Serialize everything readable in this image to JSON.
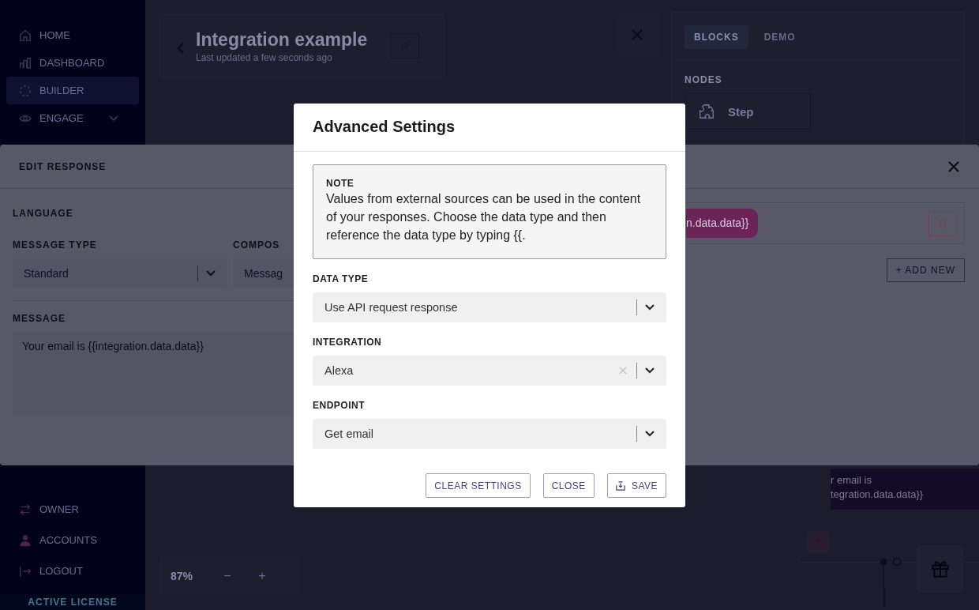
{
  "sidebar": {
    "items": [
      {
        "label": "HOME",
        "selected": false,
        "submenu": false
      },
      {
        "label": "DASHBOARD",
        "selected": false,
        "submenu": false
      },
      {
        "label": "BUILDER",
        "selected": true,
        "submenu": false
      },
      {
        "label": "ENGAGE",
        "selected": false,
        "submenu": true
      }
    ],
    "footer_items": [
      {
        "label": "OWNER"
      },
      {
        "label": "ACCOUNTS"
      },
      {
        "label": "LOGOUT"
      }
    ],
    "license": "ACTIVE LICENSE"
  },
  "header": {
    "title": "Integration example",
    "subtitle": "Last updated a few seconds ago"
  },
  "builder_panel": {
    "tabs": [
      {
        "label": "BLOCKS",
        "selected": true
      },
      {
        "label": "DEMO",
        "selected": false
      }
    ],
    "section": "NODES",
    "nodes": [
      {
        "label": "Step"
      }
    ]
  },
  "canvas": {
    "message_node": {
      "lines": [
        "r email is",
        "tegration.data.data}}"
      ]
    },
    "zoom": "87%",
    "zoom_out": "−",
    "zoom_in": "+"
  },
  "edit_response": {
    "title": "EDIT RESPONSE",
    "language_label": "LANGUAGE",
    "message_type": {
      "label": "MESSAGE TYPE",
      "value": "Standard"
    },
    "compose": {
      "label": "COMPOS",
      "value": "Messag"
    },
    "message": {
      "label": "MESSAGE",
      "value": "Your email is {{integration.data.data}}"
    },
    "variable_pill": "n.data.data}}",
    "add_new": "+ ADD NEW"
  },
  "modal": {
    "title": "Advanced Settings",
    "note": {
      "label": "NOTE",
      "text": "Values from external sources can be used in the content of your responses. Choose the data type and then reference the data type by typing {{."
    },
    "fields": [
      {
        "label": "DATA TYPE",
        "value": "Use API request response",
        "clearable": false
      },
      {
        "label": "INTEGRATION",
        "value": "Alexa",
        "clearable": true
      },
      {
        "label": "ENDPOINT",
        "value": "Get email",
        "clearable": false
      }
    ],
    "buttons": [
      {
        "label": "CLEAR SETTINGS",
        "kind": "plain"
      },
      {
        "label": "CLOSE",
        "kind": "plain"
      },
      {
        "label": "SAVE",
        "kind": "save"
      }
    ]
  }
}
